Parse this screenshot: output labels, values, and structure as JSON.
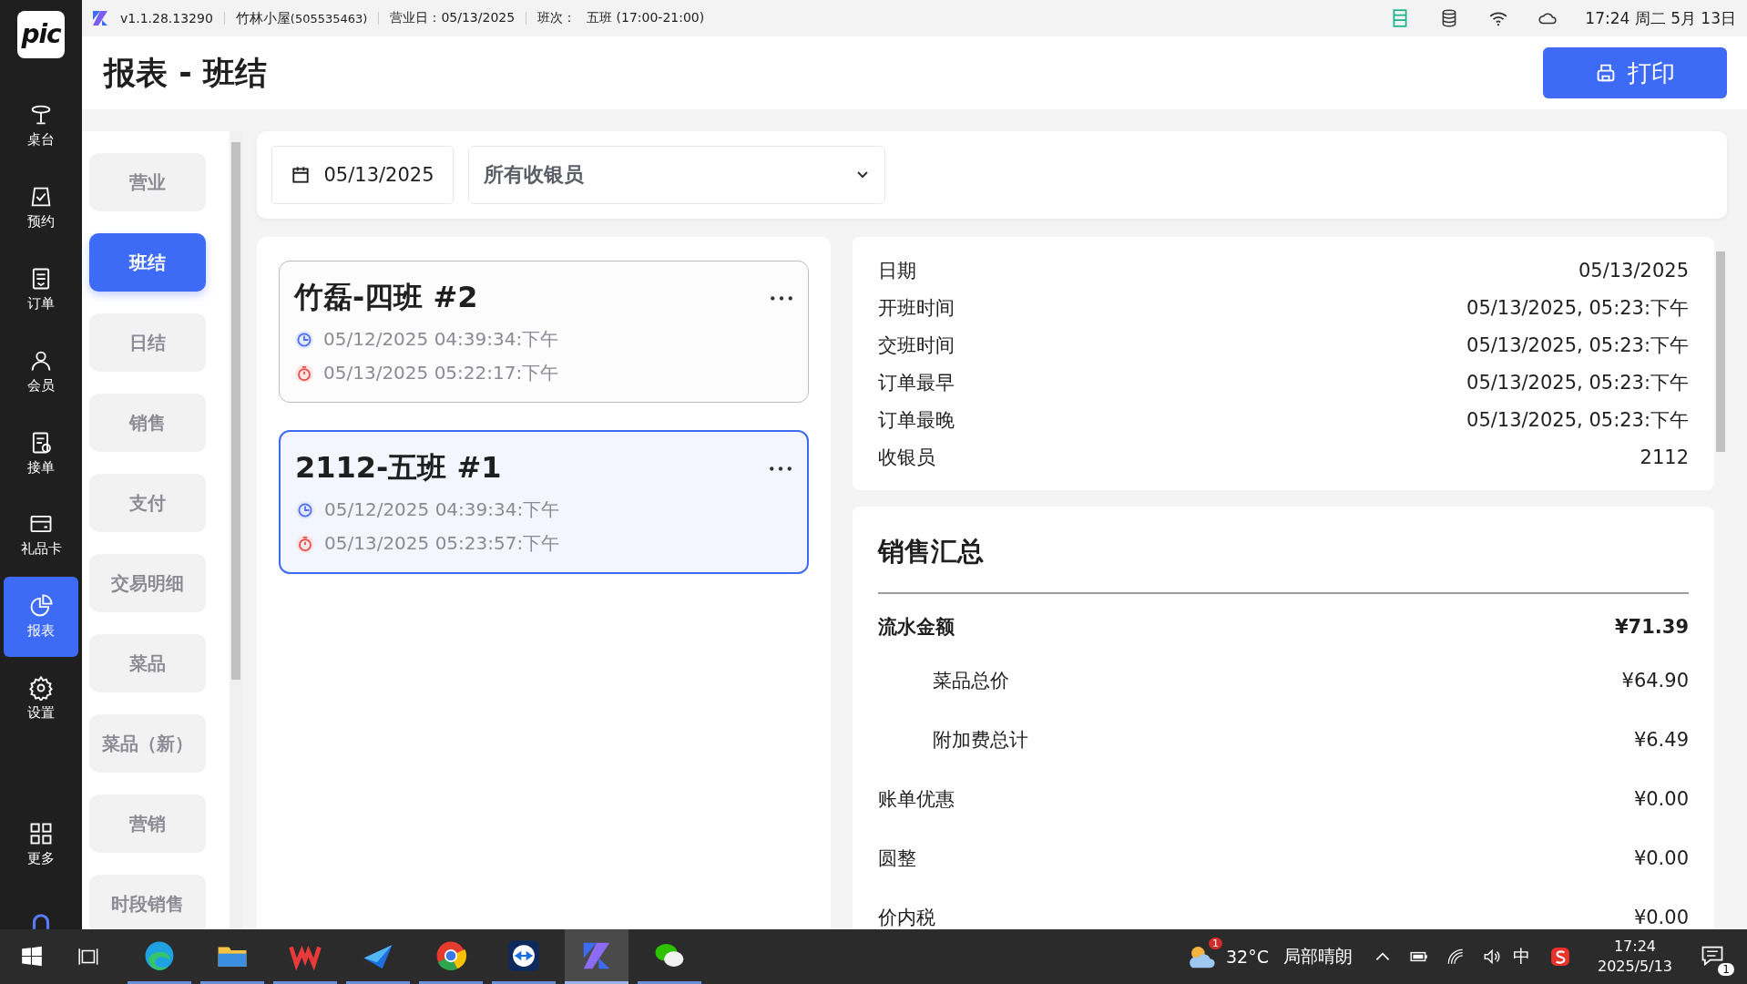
{
  "status_bar": {
    "version": "v1.1.28.13290",
    "store": "竹林小屋",
    "store_id": "(505535463)",
    "business_day": "营业日：05/13/2025",
    "shift_label": "班次：",
    "shift": "五班 (17:00-21:00)",
    "clock": "17:24 周二 5月 13日"
  },
  "logo": "pic",
  "nav": [
    {
      "label": "桌台",
      "kind": "table",
      "selected": false
    },
    {
      "label": "预约",
      "kind": "reserve",
      "selected": false
    },
    {
      "label": "订单",
      "kind": "order",
      "selected": false
    },
    {
      "label": "会员",
      "kind": "member",
      "selected": false
    },
    {
      "label": "接单",
      "kind": "accept",
      "selected": false
    },
    {
      "label": "礼品卡",
      "kind": "card",
      "selected": false
    },
    {
      "label": "报表",
      "kind": "report",
      "selected": true
    },
    {
      "label": "设置",
      "kind": "settings",
      "selected": false
    },
    {
      "label": "更多",
      "kind": "more",
      "selected": false
    }
  ],
  "page_title": "报表 - 班结",
  "print_button": "打印",
  "report_tabs": [
    {
      "label": "营业",
      "selected": false
    },
    {
      "label": "班结",
      "selected": true
    },
    {
      "label": "日结",
      "selected": false
    },
    {
      "label": "销售",
      "selected": false
    },
    {
      "label": "支付",
      "selected": false
    },
    {
      "label": "交易明细",
      "selected": false
    },
    {
      "label": "菜品",
      "selected": false
    },
    {
      "label": "菜品（新）",
      "selected": false
    },
    {
      "label": "营销",
      "selected": false
    },
    {
      "label": "时段销售",
      "selected": false
    }
  ],
  "filters": {
    "date": "05/13/2025",
    "cashier": "所有收银员"
  },
  "shifts": [
    {
      "title": "竹磊-四班 #2",
      "start": "05/12/2025 04:39:34:下午",
      "end": "05/13/2025 05:22:17:下午",
      "selected": false
    },
    {
      "title": "2112-五班 #1",
      "start": "05/12/2025 04:39:34:下午",
      "end": "05/13/2025 05:23:57:下午",
      "selected": true
    }
  ],
  "details": [
    {
      "label": "日期",
      "value": "05/13/2025"
    },
    {
      "label": "开班时间",
      "value": "05/13/2025, 05:23:下午"
    },
    {
      "label": "交班时间",
      "value": "05/13/2025, 05:23:下午"
    },
    {
      "label": "订单最早",
      "value": "05/13/2025, 05:23:下午"
    },
    {
      "label": "订单最晚",
      "value": "05/13/2025, 05:23:下午"
    },
    {
      "label": "收银员",
      "value": "2112"
    }
  ],
  "sales_summary": {
    "title": "销售汇总",
    "rows": [
      {
        "label": "流水金额",
        "value": "¥71.39",
        "kind": "total"
      },
      {
        "label": "菜品总价",
        "value": "¥64.90",
        "kind": "sub"
      },
      {
        "label": "附加费总计",
        "value": "¥6.49",
        "kind": "sub"
      },
      {
        "label": "账单优惠",
        "value": "¥0.00",
        "kind": "item"
      },
      {
        "label": "圆整",
        "value": "¥0.00",
        "kind": "item"
      },
      {
        "label": "价内税",
        "value": "¥0.00",
        "kind": "item"
      }
    ]
  },
  "taskbar": {
    "apps": [
      {
        "kind": "edge",
        "selected": false
      },
      {
        "kind": "folder",
        "selected": false
      },
      {
        "kind": "wps",
        "selected": false
      },
      {
        "kind": "mail",
        "selected": false
      },
      {
        "kind": "chrome",
        "selected": false
      },
      {
        "kind": "remote",
        "selected": false
      },
      {
        "kind": "pos",
        "selected": true
      },
      {
        "kind": "chat",
        "selected": false
      }
    ],
    "weather_badge": "1",
    "weather": "32°C",
    "weather_text": "局部晴朗",
    "ime": "中",
    "time": "17:24",
    "date": "2025/5/13",
    "notifications": "1"
  }
}
